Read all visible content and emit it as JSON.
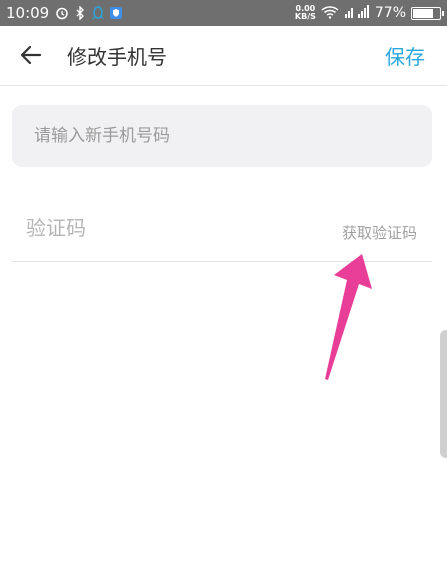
{
  "status_bar": {
    "time": "10:09",
    "net_speed_value": "0.00",
    "net_speed_unit": "KB/S",
    "network_label": "4G",
    "battery_percent": "77%",
    "battery_level": 0.77
  },
  "header": {
    "title": "修改手机号",
    "save_label": "保存"
  },
  "form": {
    "phone_placeholder": "请输入新手机号码",
    "code_placeholder": "验证码",
    "get_code_label": "获取验证码"
  },
  "colors": {
    "accent": "#2aa7de",
    "annotation_arrow": "#e83e97",
    "status_bar": "#6f6f6f"
  }
}
